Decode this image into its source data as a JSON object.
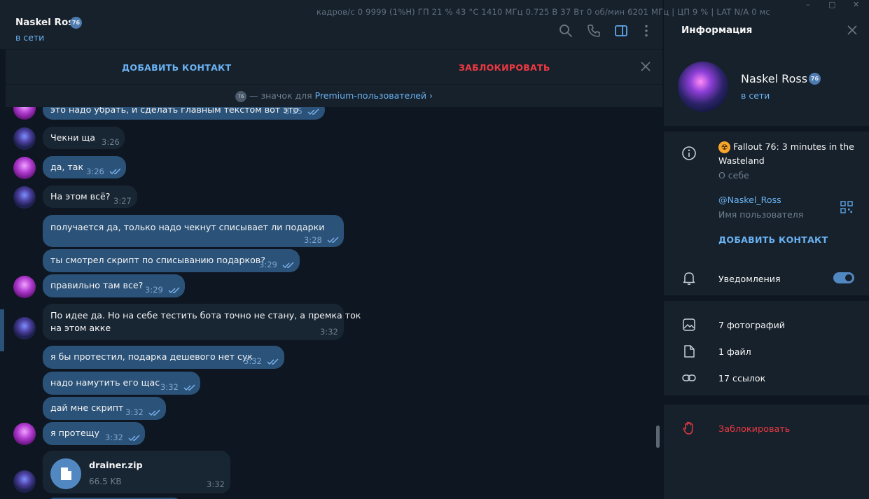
{
  "overlay": {
    "stats": "кадров/с 0 9999 (1%Н) ГП 21 % 43 °С 1410 МГц 0.725 В 37 Вт 0 об/мин 6201 МГц | ЦП 9 % | LAT N/A 0 мс"
  },
  "window_controls": {
    "minimize": "–",
    "maximize": "▢",
    "close": "✕"
  },
  "chat_header": {
    "peer_name": "Naskel Ross",
    "badge": "76",
    "status": "в сети"
  },
  "action_bar": {
    "add_contact": "ДОБАВИТЬ КОНТАКТ",
    "block": "ЗАБЛОКИРОВАТЬ"
  },
  "premium_bar": {
    "prefix": "— значок для ",
    "link": "Premium-пользователей ›"
  },
  "messages": [
    {
      "dir": "out",
      "text": "это надо убрать, и сделать главным текстом вот это",
      "time": "3:25",
      "read": true
    },
    {
      "dir": "in",
      "text": "Чекни ща",
      "time": "3:26"
    },
    {
      "dir": "out",
      "text": "да, так",
      "time": "3:26",
      "read": true
    },
    {
      "dir": "in",
      "text": "На этом всё?",
      "time": "3:27"
    },
    {
      "dir": "out",
      "text": "получается да, только надо чекнут списывает ли подарки",
      "time": "3:28",
      "read": true
    },
    {
      "dir": "out",
      "text": "ты смотрел скрипт по списыванию подарков?",
      "time": "3:29",
      "read": true
    },
    {
      "dir": "out",
      "text": "правильно там все?",
      "time": "3:29",
      "read": true
    },
    {
      "dir": "in",
      "line1": "По идее да. Но на себе тестить бота точно не стану, а премка ток",
      "line2": "на этом акке",
      "time": "3:32"
    },
    {
      "dir": "out",
      "text": "я бы протестил, подарка дешевого нет сук",
      "time": "3:32",
      "read": true
    },
    {
      "dir": "out",
      "text": "надо намутить его щас",
      "time": "3:32",
      "read": true
    },
    {
      "dir": "out",
      "text": "дай мне скрипт",
      "time": "3:32",
      "read": true
    },
    {
      "dir": "out",
      "text": "я протещу",
      "time": "3:32",
      "read": true
    }
  ],
  "file_message": {
    "name": "drainer.zip",
    "size": "66.5 KB",
    "time": "3:32"
  },
  "info_panel": {
    "title": "Информация",
    "name": "Naskel Ross",
    "badge": "76",
    "status": "в сети",
    "bio_emoji": "☢",
    "bio": "Fallout 76: 3 minutes in the",
    "bio_line2": "Wasteland",
    "bio_label": "О себе",
    "username": "@Naskel_Ross",
    "username_label": "Имя пользователя",
    "add_contact": "ДОБАВИТЬ КОНТАКТ",
    "notifications": "Уведомления",
    "notifications_on": true,
    "photos": "7 фотографий",
    "files": "1 файл",
    "links": "17 ссылок",
    "block": "Заблокировать"
  },
  "colors": {
    "bg": "#0e1621",
    "panel": "#17212b",
    "out_bubble": "#2b5278",
    "in_bubble": "#182533",
    "accent": "#6ab2f2",
    "danger": "#ec3942"
  }
}
